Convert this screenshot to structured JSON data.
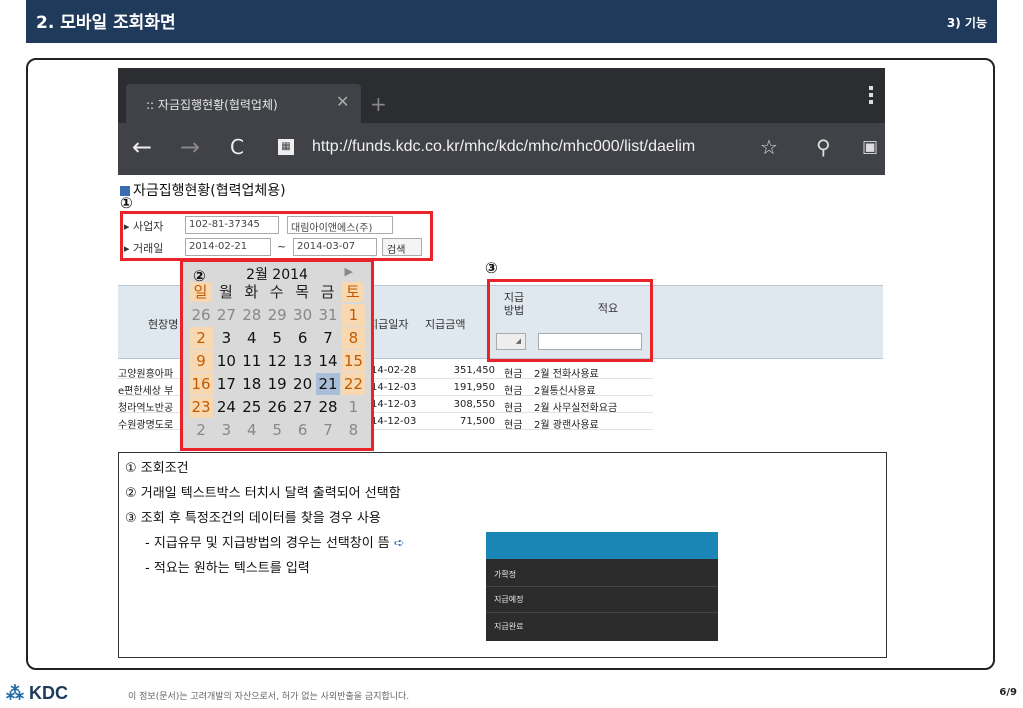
{
  "header": {
    "title": "2. 모바일 조회화면",
    "section": "3) 기능"
  },
  "browser": {
    "tab_title": ":: 자금집행현황(협력업체)",
    "url": "http://funds.kdc.co.kr/mhc/kdc/mhc/mhc000/list/daelim"
  },
  "page": {
    "title": "자금집행현황(협력업체용)",
    "filter": {
      "biz_label": "사업자",
      "biz_no": "102-81-37345",
      "company": "대림아이앤에스(주)",
      "date_label": "거래일",
      "date_from": "2014-02-21",
      "tilde": "~",
      "date_to": "2014-03-07",
      "search_btn": "검색"
    }
  },
  "markers": {
    "m1": "①",
    "m2": "②",
    "m3": "③"
  },
  "calendar": {
    "month_label": "2월 2014",
    "next": "▶",
    "weekdays": [
      "일",
      "월",
      "화",
      "수",
      "목",
      "금",
      "토"
    ],
    "rows": [
      [
        "26",
        "27",
        "28",
        "29",
        "30",
        "31",
        "1"
      ],
      [
        "2",
        "3",
        "4",
        "5",
        "6",
        "7",
        "8"
      ],
      [
        "9",
        "10",
        "11",
        "12",
        "13",
        "14",
        "15"
      ],
      [
        "16",
        "17",
        "18",
        "19",
        "20",
        "21",
        "22"
      ],
      [
        "23",
        "24",
        "25",
        "26",
        "27",
        "28",
        "1"
      ],
      [
        "2",
        "3",
        "4",
        "5",
        "6",
        "7",
        "8"
      ]
    ]
  },
  "table": {
    "headers": {
      "site": "현장명",
      "date": "지급일자",
      "amount": "지급금액",
      "method": "지급\n방법",
      "memo": "적요"
    },
    "rows": [
      {
        "site": "고양원흥아파",
        "date": "14-02-28",
        "amount": "351,450",
        "method": "현금",
        "memo": "2월 전화사용료"
      },
      {
        "site": "e편한세상 부",
        "date": "14-12-03",
        "amount": "191,950",
        "method": "현금",
        "memo": "2월통신사용료"
      },
      {
        "site": "청라역노반공",
        "date": "14-12-03",
        "amount": "308,550",
        "method": "현금",
        "memo": "2월 사무실전화요금"
      },
      {
        "site": "수원광명도로",
        "date": "14-12-03",
        "amount": "71,500",
        "method": "현금",
        "memo": "2월 광랜사용료"
      }
    ]
  },
  "description": {
    "l1": "① 조회조건",
    "l2": "② 거래일 텍스트박스 터치시 달력 출력되어 선택함",
    "l3": "③ 조회 후 특정조건의 데이터를 찾을 경우 사용",
    "l4": "- 지급유무 및 지급방법의 경우는 선택창이 뜸",
    "l5": "- 적요는 원하는 텍스트를 입력"
  },
  "popup": {
    "items": [
      "가확정",
      "지급예정",
      "지급완료"
    ]
  },
  "footer": {
    "logo": "KDC",
    "notice": "이 정보(문서)는 고려개발의 자산으로서, 허가 없는 사외반출을 금지합니다.",
    "page": "6/9"
  }
}
